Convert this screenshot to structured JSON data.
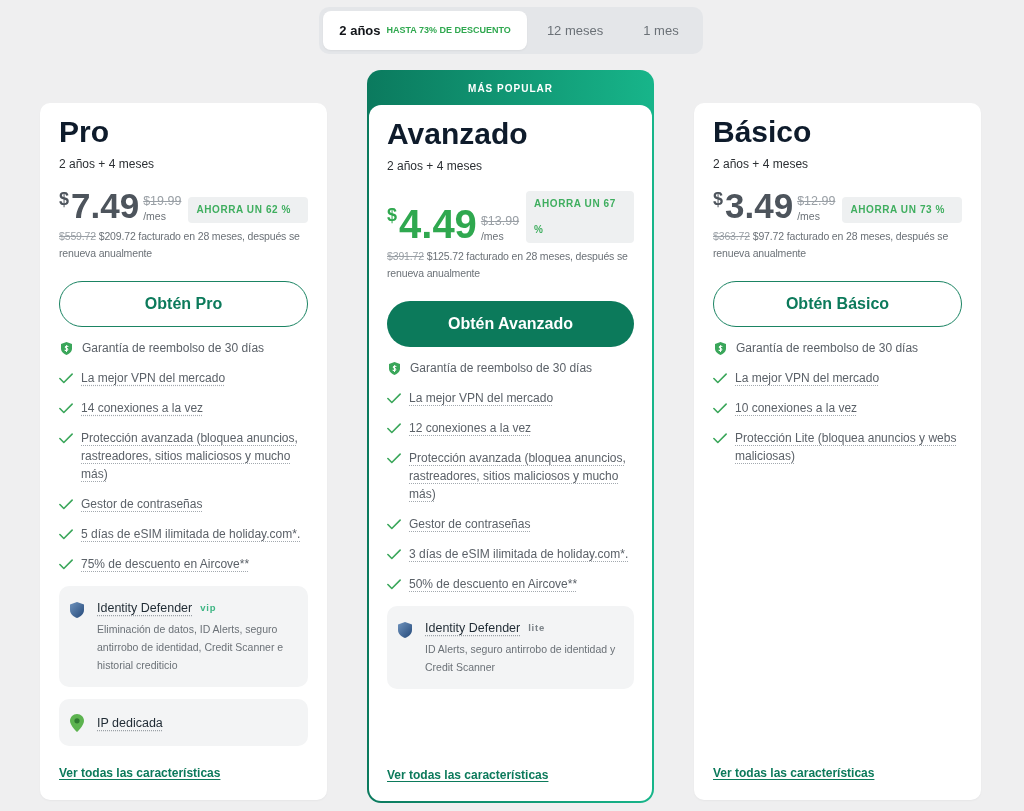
{
  "billing_tabs": [
    {
      "label": "2 años",
      "badge": "HASTA 73% DE DESCUENTO",
      "selected": true
    },
    {
      "label": "12 meses",
      "selected": false
    },
    {
      "label": "1 mes",
      "selected": false
    }
  ],
  "plans": [
    {
      "name": "Pro",
      "featured": false,
      "period": "2 años + 4 meses",
      "currency": "$",
      "price": "7.49",
      "old_price": "$19.99",
      "per": "/mes",
      "savings": "AHORRA UN 62 %",
      "old_total": "$559.72",
      "billing": "$209.72 facturado en 28 meses, después se renueva anualmente",
      "cta": "Obtén Pro",
      "features": [
        {
          "kind": "guarantee",
          "text": "Garantía de reembolso de 30 días"
        },
        {
          "kind": "check",
          "text": "La mejor VPN del mercado"
        },
        {
          "kind": "check",
          "text": "14 conexiones a la vez"
        },
        {
          "kind": "check",
          "text": "Protección avanzada (bloquea anuncios, rastreadores, sitios maliciosos y mucho más)"
        },
        {
          "kind": "check",
          "text": "Gestor de contraseñas"
        },
        {
          "kind": "check",
          "text": "5 días de eSIM ilimitada de holiday.com*."
        },
        {
          "kind": "check",
          "text": "75% de descuento en Aircove**"
        }
      ],
      "addons": [
        {
          "kind": "identity",
          "title": "Identity Defender",
          "tag": "vip",
          "color": "#3db583",
          "description": "Eliminación de datos, ID Alerts, seguro antirrobo de identidad, Credit Scanner e historial crediticio"
        },
        {
          "kind": "ip",
          "title": "IP dedicada"
        }
      ],
      "link": "Ver todas las características"
    },
    {
      "name": "Avanzado",
      "featured": true,
      "ribbon": "MÁS POPULAR",
      "period": "2 años + 4 meses",
      "currency": "$",
      "price": "4.49",
      "old_price": "$13.99",
      "per": "/mes",
      "savings": "AHORRA UN 67 %",
      "old_total": "$391.72",
      "billing": "$125.72 facturado en 28 meses, después se renueva anualmente",
      "cta": "Obtén Avanzado",
      "features": [
        {
          "kind": "guarantee",
          "text": "Garantía de reembolso de 30 días"
        },
        {
          "kind": "check",
          "text": "La mejor VPN del mercado"
        },
        {
          "kind": "check",
          "text": "12 conexiones a la vez"
        },
        {
          "kind": "check",
          "text": "Protección avanzada (bloquea anuncios, rastreadores, sitios maliciosos y mucho más)"
        },
        {
          "kind": "check",
          "text": "Gestor de contraseñas"
        },
        {
          "kind": "check",
          "text": "3 días de eSIM ilimitada de holiday.com*."
        },
        {
          "kind": "check",
          "text": "50% de descuento en Aircove**"
        }
      ],
      "addons": [
        {
          "kind": "identity",
          "title": "Identity Defender",
          "tag": "lite",
          "color": "#7b8288",
          "description": "ID Alerts, seguro antirrobo de identidad y Credit Scanner"
        }
      ],
      "link": "Ver todas las características"
    },
    {
      "name": "Básico",
      "featured": false,
      "period": "2 años + 4 meses",
      "currency": "$",
      "price": "3.49",
      "old_price": "$12.99",
      "per": "/mes",
      "savings": "AHORRA UN 73 %",
      "old_total": "$363.72",
      "billing": "$97.72 facturado en 28 meses, después se renueva anualmente",
      "cta": "Obtén Básico",
      "features": [
        {
          "kind": "guarantee",
          "text": "Garantía de reembolso de 30 días"
        },
        {
          "kind": "check",
          "text": "La mejor VPN del mercado"
        },
        {
          "kind": "check",
          "text": "10 conexiones a la vez"
        },
        {
          "kind": "check",
          "text": "Protección Lite (bloquea anuncios y webs maliciosas)"
        }
      ],
      "link": "Ver todas las características"
    }
  ]
}
